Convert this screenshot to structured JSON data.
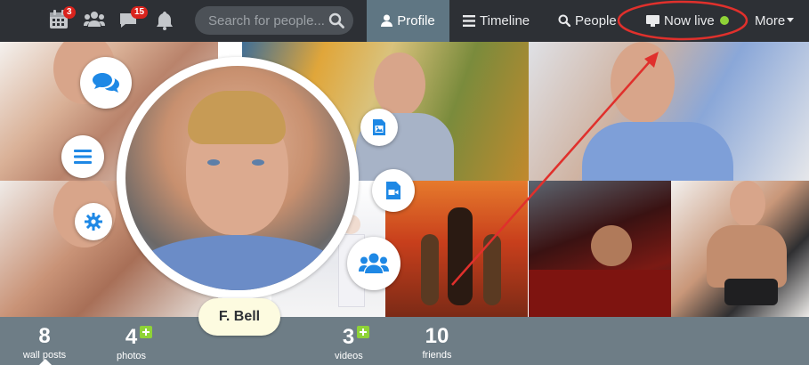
{
  "nav": {
    "events_badge": "3",
    "messages_badge": "15",
    "search_placeholder": "Search for people...",
    "profile": "Profile",
    "timeline": "Timeline",
    "people": "People",
    "now_live": "Now live",
    "more": "More"
  },
  "profile": {
    "name": "F. Bell"
  },
  "stats": {
    "wall_posts": {
      "count": "8",
      "label": "wall posts"
    },
    "photos": {
      "count": "4",
      "label": "photos"
    },
    "videos": {
      "count": "3",
      "label": "videos"
    },
    "friends": {
      "count": "10",
      "label": "friends"
    }
  },
  "colors": {
    "navbar": "#2d3035",
    "active_tab": "#5f7683",
    "stats_bar": "#6e7d86",
    "badge": "#d9231d",
    "live_dot": "#8fd337",
    "accent_blue": "#1e88e5",
    "annotation": "#e0302c"
  },
  "icons": [
    "calendar-icon",
    "people-icon",
    "chat-icon",
    "bell-icon",
    "search-icon",
    "user-icon",
    "list-icon",
    "monitor-icon",
    "comment-icon",
    "menu-icon",
    "gear-icon",
    "image-icon",
    "video-icon",
    "group-icon",
    "plus-icon"
  ]
}
